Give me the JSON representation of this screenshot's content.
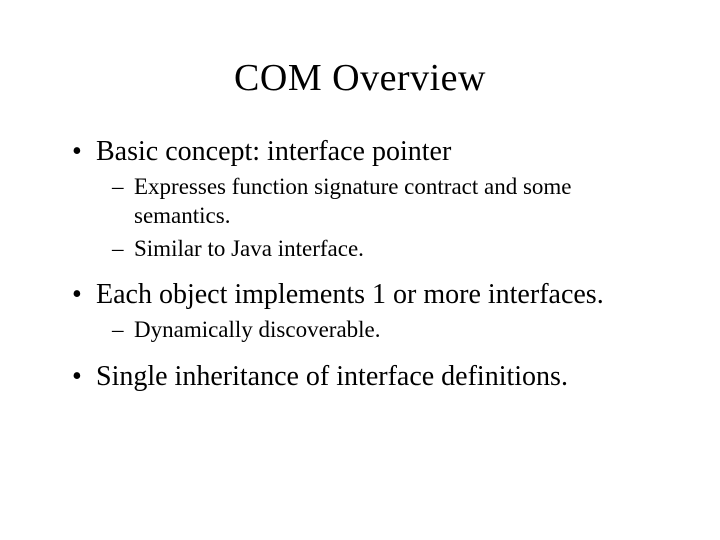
{
  "slide": {
    "title": "COM Overview",
    "bullets": [
      {
        "text": "Basic concept: interface pointer",
        "sub": [
          "Expresses function signature contract and some semantics.",
          "Similar to Java interface."
        ]
      },
      {
        "text": "Each object implements 1 or more interfaces.",
        "sub": [
          "Dynamically discoverable."
        ]
      },
      {
        "text": "Single inheritance of interface definitions.",
        "sub": []
      }
    ]
  }
}
